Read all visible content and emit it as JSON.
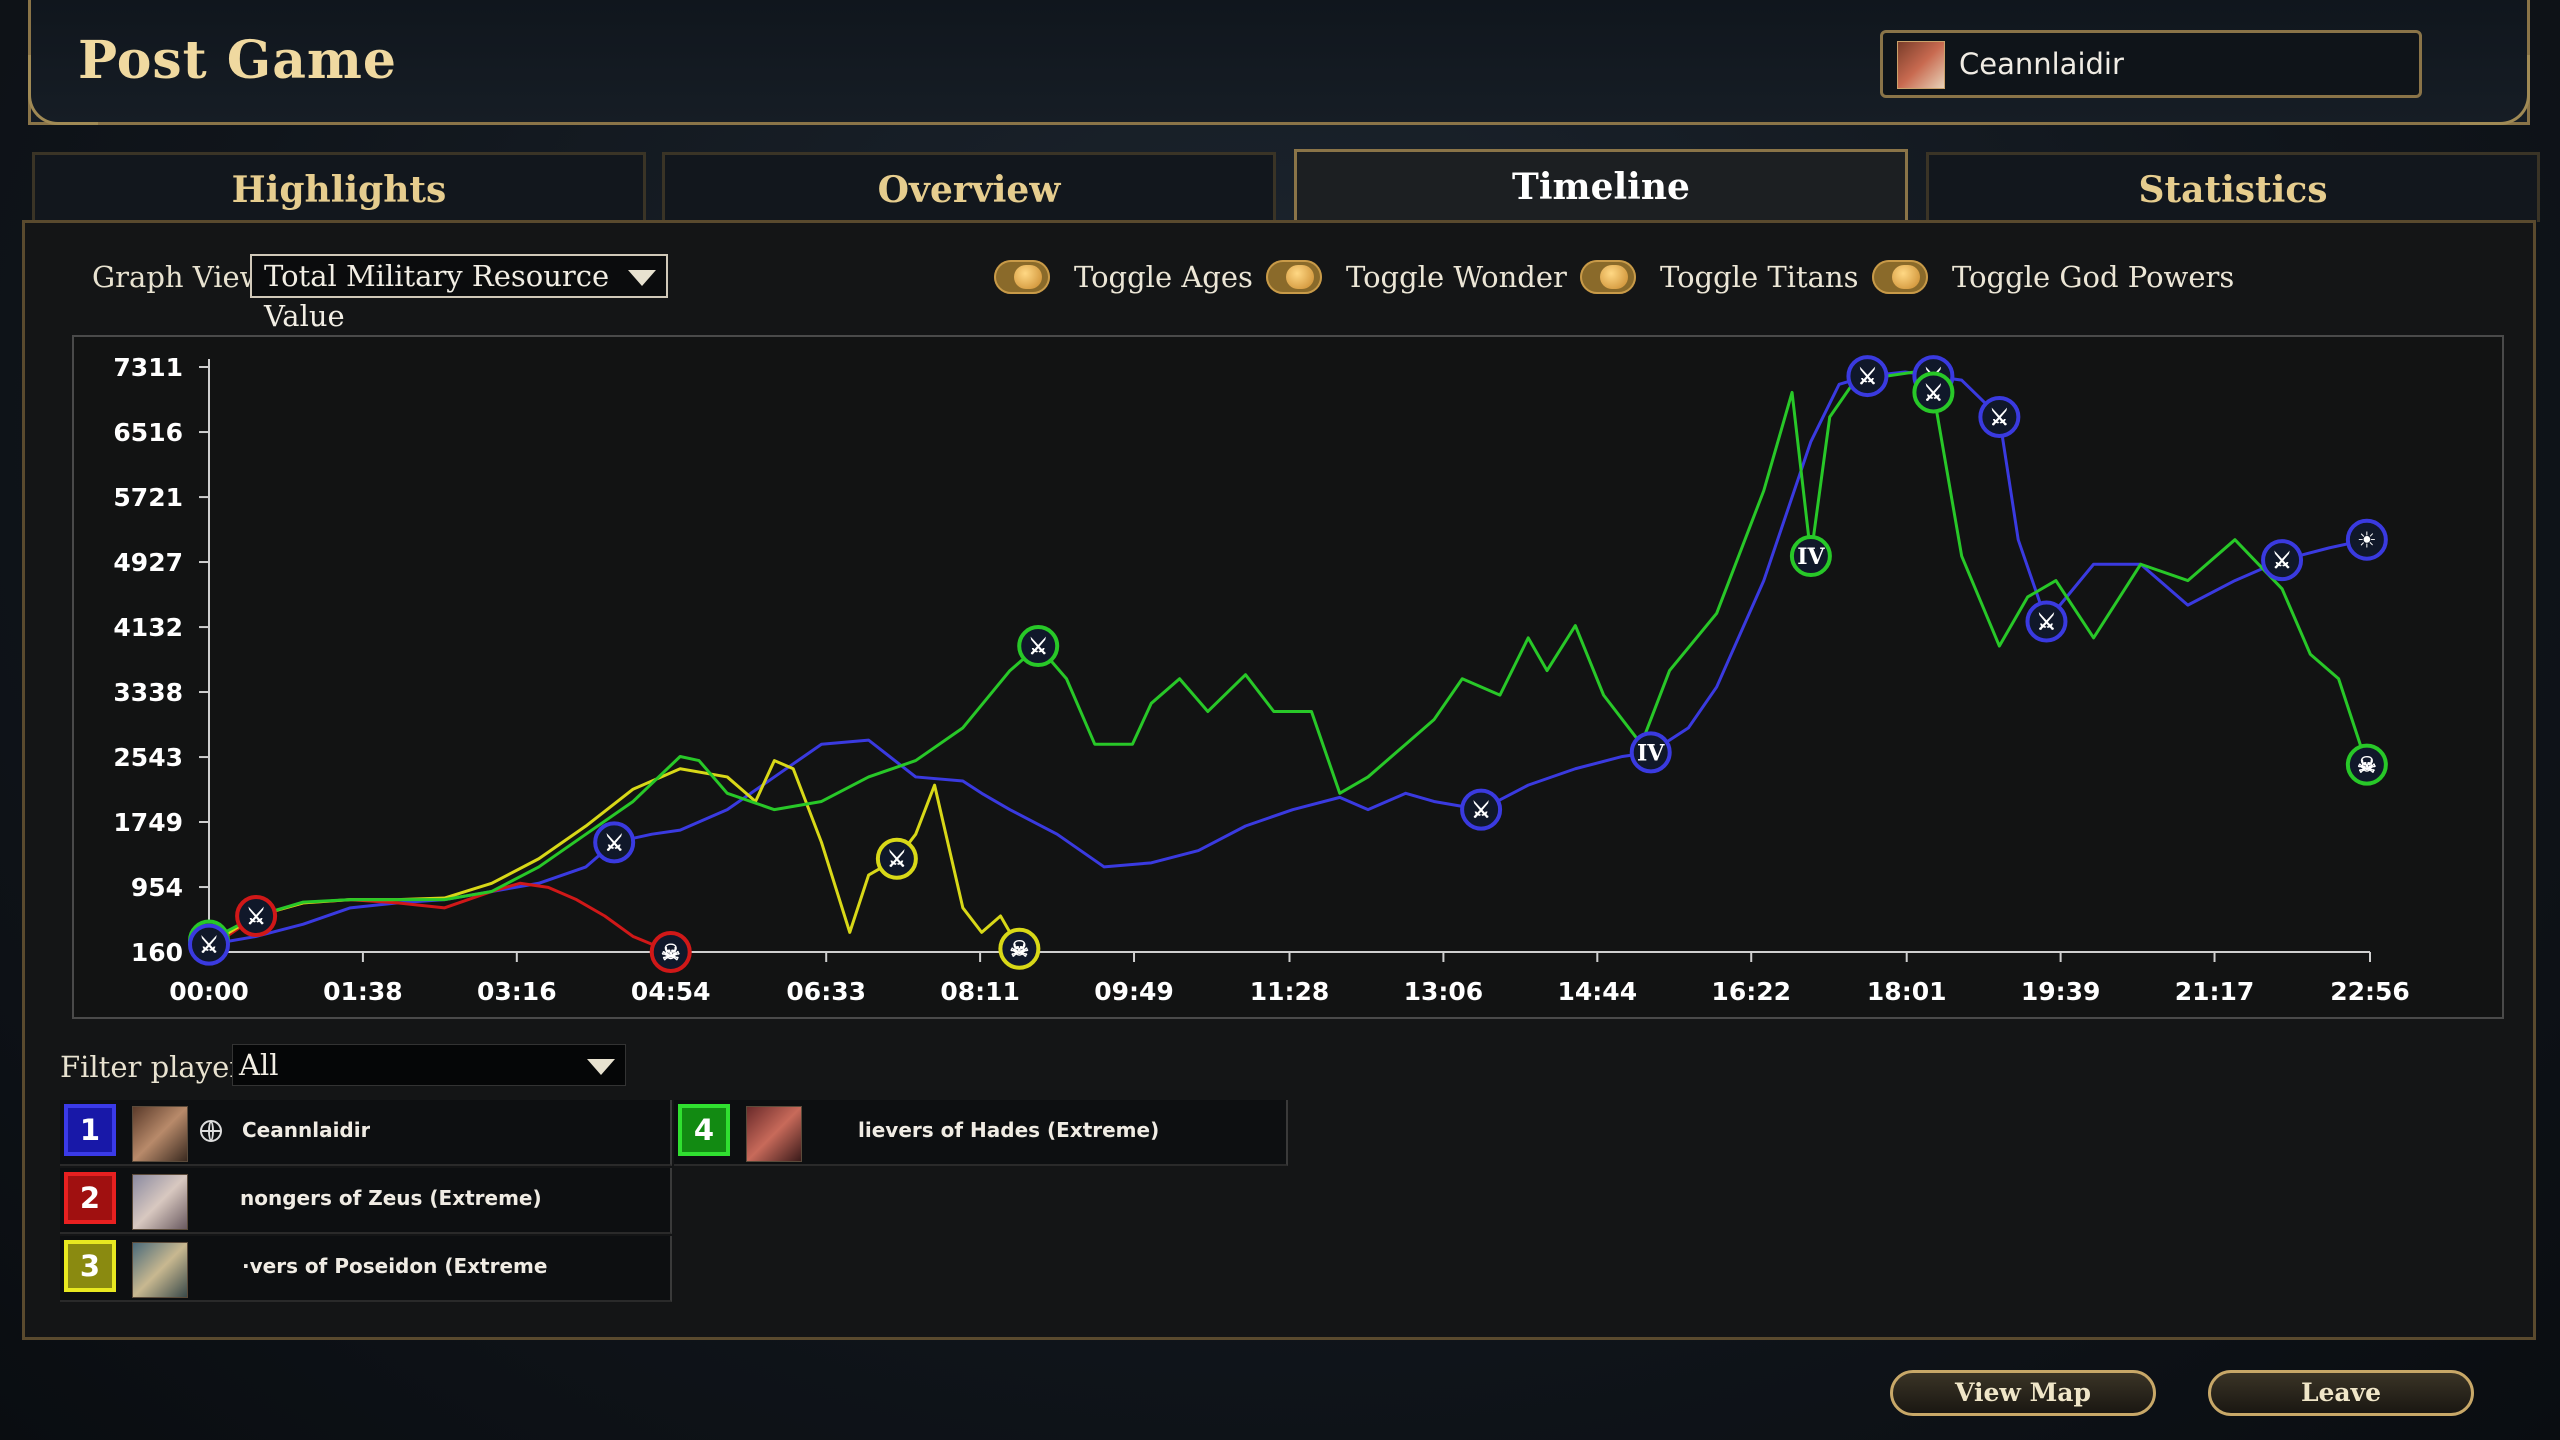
{
  "page_title": "Post Game",
  "profile": {
    "name": "Ceannlaidir"
  },
  "tabs": [
    {
      "label": "Highlights",
      "active": false
    },
    {
      "label": "Overview",
      "active": false
    },
    {
      "label": "Timeline",
      "active": true
    },
    {
      "label": "Statistics",
      "active": false
    }
  ],
  "graph_view": {
    "label": "Graph View:",
    "selected": "Total Military Resource Value"
  },
  "toggles": [
    {
      "label": "Toggle Ages",
      "on": true
    },
    {
      "label": "Toggle Wonder",
      "on": true
    },
    {
      "label": "Toggle Titans",
      "on": true
    },
    {
      "label": "Toggle God Powers",
      "on": true
    }
  ],
  "filter": {
    "label": "Filter players:",
    "selected": "All"
  },
  "players": [
    {
      "num": "1",
      "name": "Ceannlaidir",
      "color": "#2a2ad8"
    },
    {
      "num": "2",
      "name": "nongers of Zeus (Extreme)",
      "color": "#d01818"
    },
    {
      "num": "3",
      "name": "·vers of Poseidon (Extreme",
      "color": "#d8d818"
    },
    {
      "num": "4",
      "name": "lievers of Hades (Extreme)",
      "color": "#28c828"
    }
  ],
  "buttons": {
    "view_map": "View Map",
    "leave": "Leave"
  },
  "chart_data": {
    "type": "line",
    "x_unit": "game time (mm:ss)",
    "y_ticks": [
      160,
      954,
      1749,
      2543,
      3338,
      4132,
      4927,
      5721,
      6516,
      7311
    ],
    "x_ticks": [
      "00:00",
      "01:38",
      "03:16",
      "04:54",
      "06:33",
      "08:11",
      "09:49",
      "11:28",
      "13:06",
      "14:44",
      "16:22",
      "18:01",
      "19:39",
      "21:17",
      "22:56"
    ],
    "ylim": [
      160,
      7311
    ],
    "series": [
      {
        "color": "#3a3ae0",
        "x": [
          0,
          0.5,
          1,
          1.5,
          2,
          2.5,
          3,
          3.5,
          4,
          4.3,
          4.7,
          5,
          5.5,
          6,
          6.5,
          7,
          7.5,
          8,
          8.2,
          8.5,
          9,
          9.5,
          10,
          10.5,
          11,
          11.5,
          12,
          12.3,
          12.7,
          13,
          13.5,
          14,
          14.5,
          15,
          15.3,
          15.7,
          16,
          16.5,
          17,
          17.3,
          17.6,
          18,
          18.3,
          18.6,
          19,
          19.2,
          19.5,
          20,
          20.5,
          21,
          21.5,
          22,
          22.5,
          22.9
        ],
        "y": [
          250,
          350,
          500,
          700,
          760,
          800,
          900,
          1000,
          1200,
          1500,
          1600,
          1650,
          1900,
          2300,
          2700,
          2750,
          2300,
          2250,
          2100,
          1900,
          1600,
          1200,
          1250,
          1400,
          1700,
          1900,
          2050,
          1900,
          2100,
          2000,
          1900,
          2200,
          2400,
          2550,
          2600,
          2900,
          3400,
          4700,
          6400,
          7100,
          7200,
          7250,
          7200,
          7150,
          6700,
          5200,
          4200,
          4900,
          4900,
          4400,
          4700,
          4950,
          5100,
          5200
        ]
      },
      {
        "color": "#d01818",
        "x": [
          0,
          0.5,
          1,
          1.5,
          2,
          2.5,
          3,
          3.3,
          3.6,
          3.9,
          4.2,
          4.5,
          4.9
        ],
        "y": [
          200,
          600,
          760,
          800,
          760,
          700,
          900,
          1000,
          950,
          800,
          600,
          350,
          160
        ]
      },
      {
        "color": "#d8d818",
        "x": [
          0,
          0.5,
          1,
          1.5,
          2,
          2.5,
          3,
          3.5,
          4,
          4.5,
          5,
          5.5,
          5.8,
          6,
          6.2,
          6.5,
          6.8,
          7,
          7.3,
          7.5,
          7.7,
          8,
          8.2,
          8.4,
          8.6
        ],
        "y": [
          250,
          600,
          760,
          800,
          800,
          820,
          1000,
          1300,
          1700,
          2150,
          2400,
          2300,
          2000,
          2500,
          2400,
          1500,
          400,
          1100,
          1300,
          1600,
          2200,
          700,
          400,
          600,
          200
        ]
      },
      {
        "color": "#28c828",
        "x": [
          0,
          0.5,
          1,
          1.5,
          2,
          2.5,
          3,
          3.5,
          4,
          4.5,
          5,
          5.2,
          5.5,
          6,
          6.5,
          7,
          7.5,
          8,
          8.5,
          8.8,
          9.1,
          9.4,
          9.8,
          10,
          10.3,
          10.6,
          11,
          11.3,
          11.7,
          12,
          12.3,
          12.7,
          13,
          13.3,
          13.7,
          14,
          14.2,
          14.5,
          14.8,
          15.2,
          15.5,
          16,
          16.5,
          16.8,
          17,
          17.2,
          17.5,
          17.8,
          18.1,
          18.3,
          18.6,
          19,
          19.3,
          19.6,
          20,
          20.5,
          21,
          21.5,
          22,
          22.3,
          22.6,
          22.9
        ],
        "y": [
          300,
          600,
          770,
          800,
          800,
          800,
          900,
          1200,
          1600,
          2000,
          2550,
          2500,
          2100,
          1900,
          2000,
          2300,
          2500,
          2900,
          3600,
          3900,
          3500,
          2700,
          2700,
          3200,
          3500,
          3100,
          3550,
          3100,
          3100,
          2100,
          2300,
          2700,
          3000,
          3500,
          3300,
          4000,
          3600,
          4150,
          3300,
          2700,
          3600,
          4300,
          5800,
          7000,
          5000,
          6700,
          7200,
          7200,
          7250,
          7000,
          5000,
          3900,
          4500,
          4700,
          4000,
          4900,
          4700,
          5200,
          4600,
          3800,
          3500,
          2450
        ]
      }
    ]
  }
}
